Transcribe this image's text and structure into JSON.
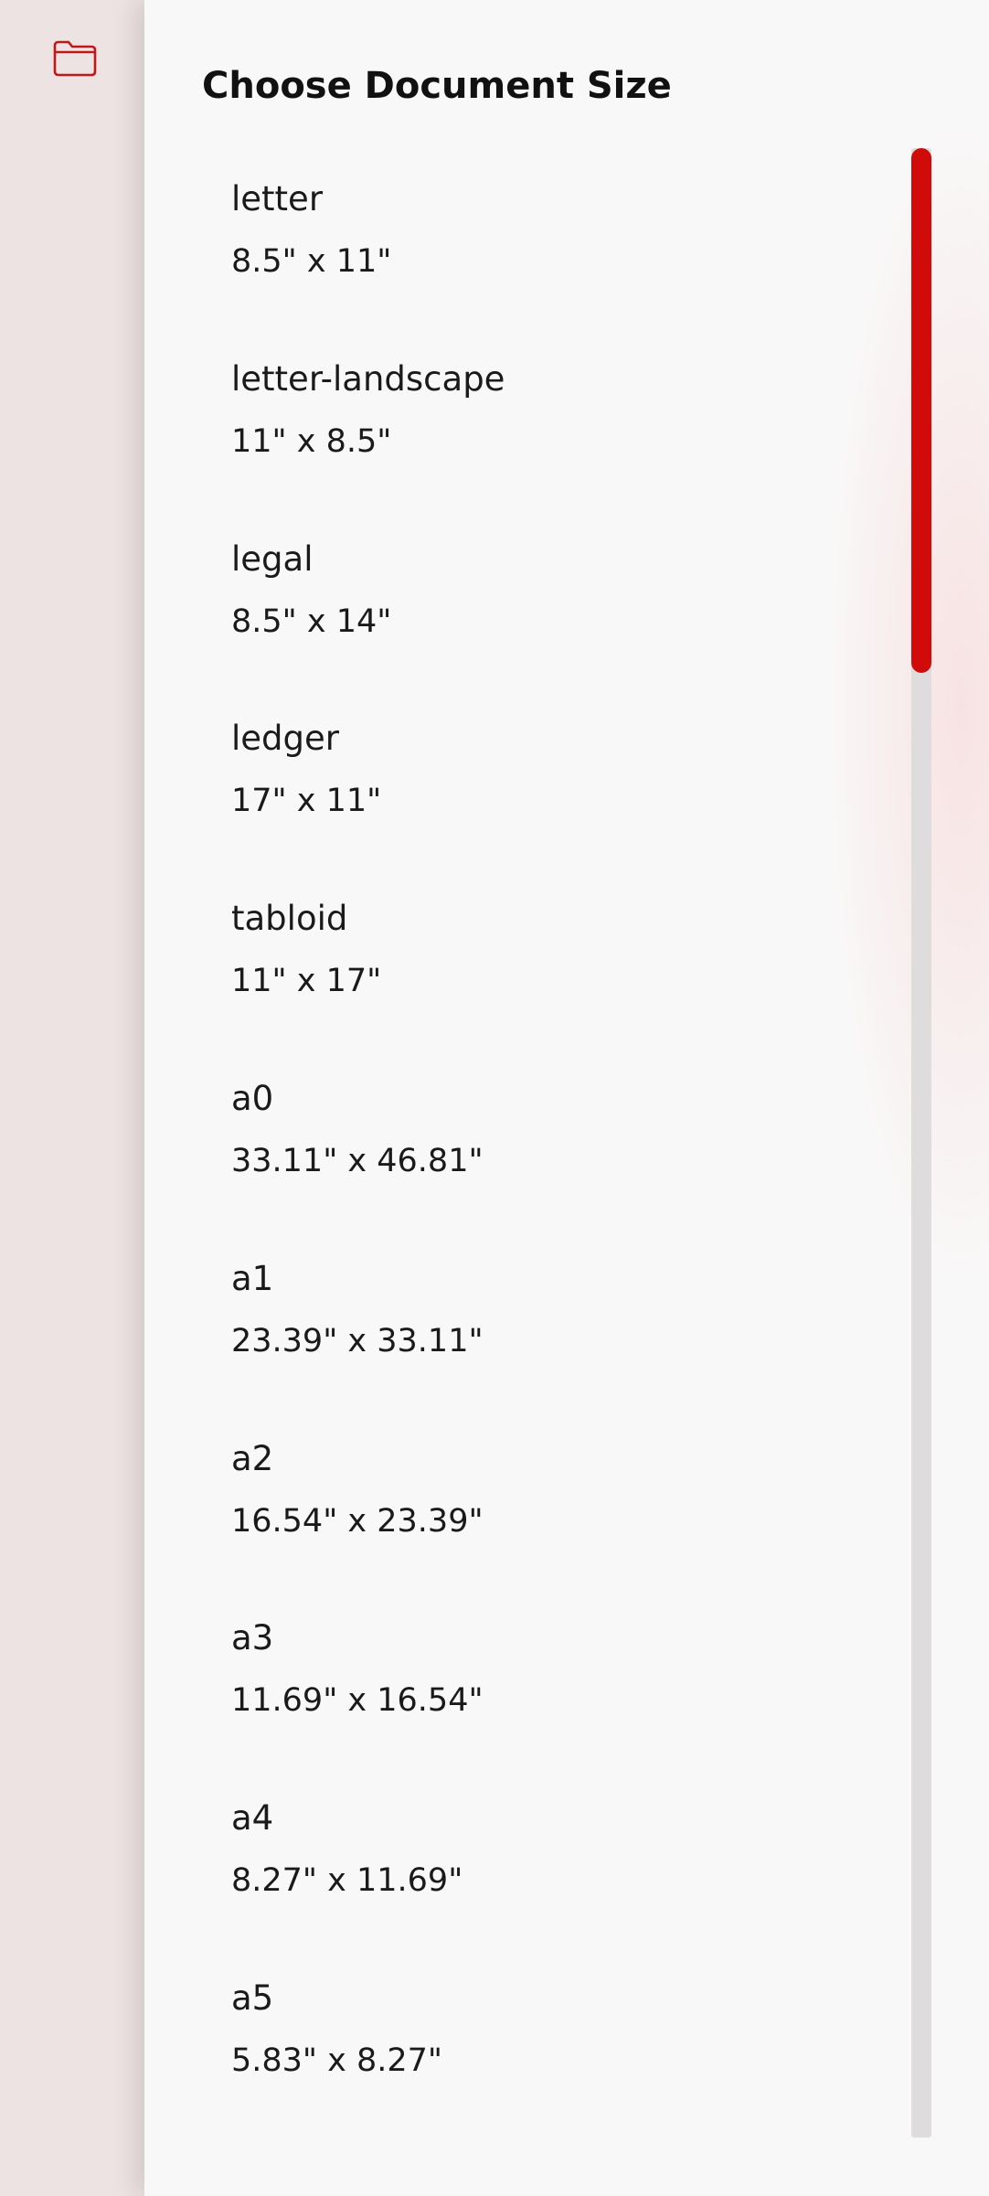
{
  "sidebar": {
    "folder_icon": "folder-icon",
    "icon_color": "#c01818"
  },
  "dialog": {
    "title": "Choose Document Size",
    "items": [
      {
        "name": "letter",
        "dims": "8.5\" x 11\""
      },
      {
        "name": "letter-landscape",
        "dims": "11\" x 8.5\""
      },
      {
        "name": "legal",
        "dims": "8.5\" x 14\""
      },
      {
        "name": "ledger",
        "dims": "17\" x 11\""
      },
      {
        "name": "tabloid",
        "dims": "11\" x 17\""
      },
      {
        "name": "a0",
        "dims": "33.11\" x 46.81\""
      },
      {
        "name": "a1",
        "dims": "23.39\" x 33.11\""
      },
      {
        "name": "a2",
        "dims": "16.54\" x 23.39\""
      },
      {
        "name": "a3",
        "dims": "11.69\" x 16.54\""
      },
      {
        "name": "a4",
        "dims": "8.27\" x 11.69\""
      },
      {
        "name": "a5",
        "dims": "5.83\" x 8.27\""
      }
    ]
  },
  "scrollbar": {
    "thumb_fraction": 0.264,
    "scroll_position": 0,
    "accent_color": "#d10a0a",
    "track_color": "#dedcdc"
  }
}
